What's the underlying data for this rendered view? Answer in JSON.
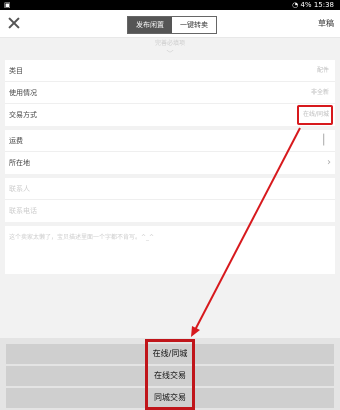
{
  "status": {
    "time": "15:38",
    "battery": "4%"
  },
  "header": {
    "tabs": [
      {
        "label": "发布闲置"
      },
      {
        "label": "一键转卖"
      }
    ],
    "draft_label": "草稿"
  },
  "hint": {
    "text": "完善必填项"
  },
  "form": {
    "category": {
      "label": "类目",
      "value": "配件"
    },
    "usage": {
      "label": "使用情况",
      "value": "非全新"
    },
    "trade": {
      "label": "交易方式",
      "value": "在线/同城"
    },
    "shipping": {
      "label": "运费"
    },
    "location": {
      "label": "所在地"
    },
    "contact_name": {
      "placeholder": "联系人"
    },
    "contact_phone": {
      "placeholder": "联系电话"
    },
    "description": {
      "placeholder": "这个卖家太懒了，宝贝描述里面一个字都不肯写。^_^"
    }
  },
  "sheet": {
    "options": [
      {
        "label": "在线/同城"
      },
      {
        "label": "在线交易"
      },
      {
        "label": "同城交易"
      }
    ]
  },
  "colors": {
    "highlight": "#d7191d",
    "tab_active": "#555555"
  }
}
